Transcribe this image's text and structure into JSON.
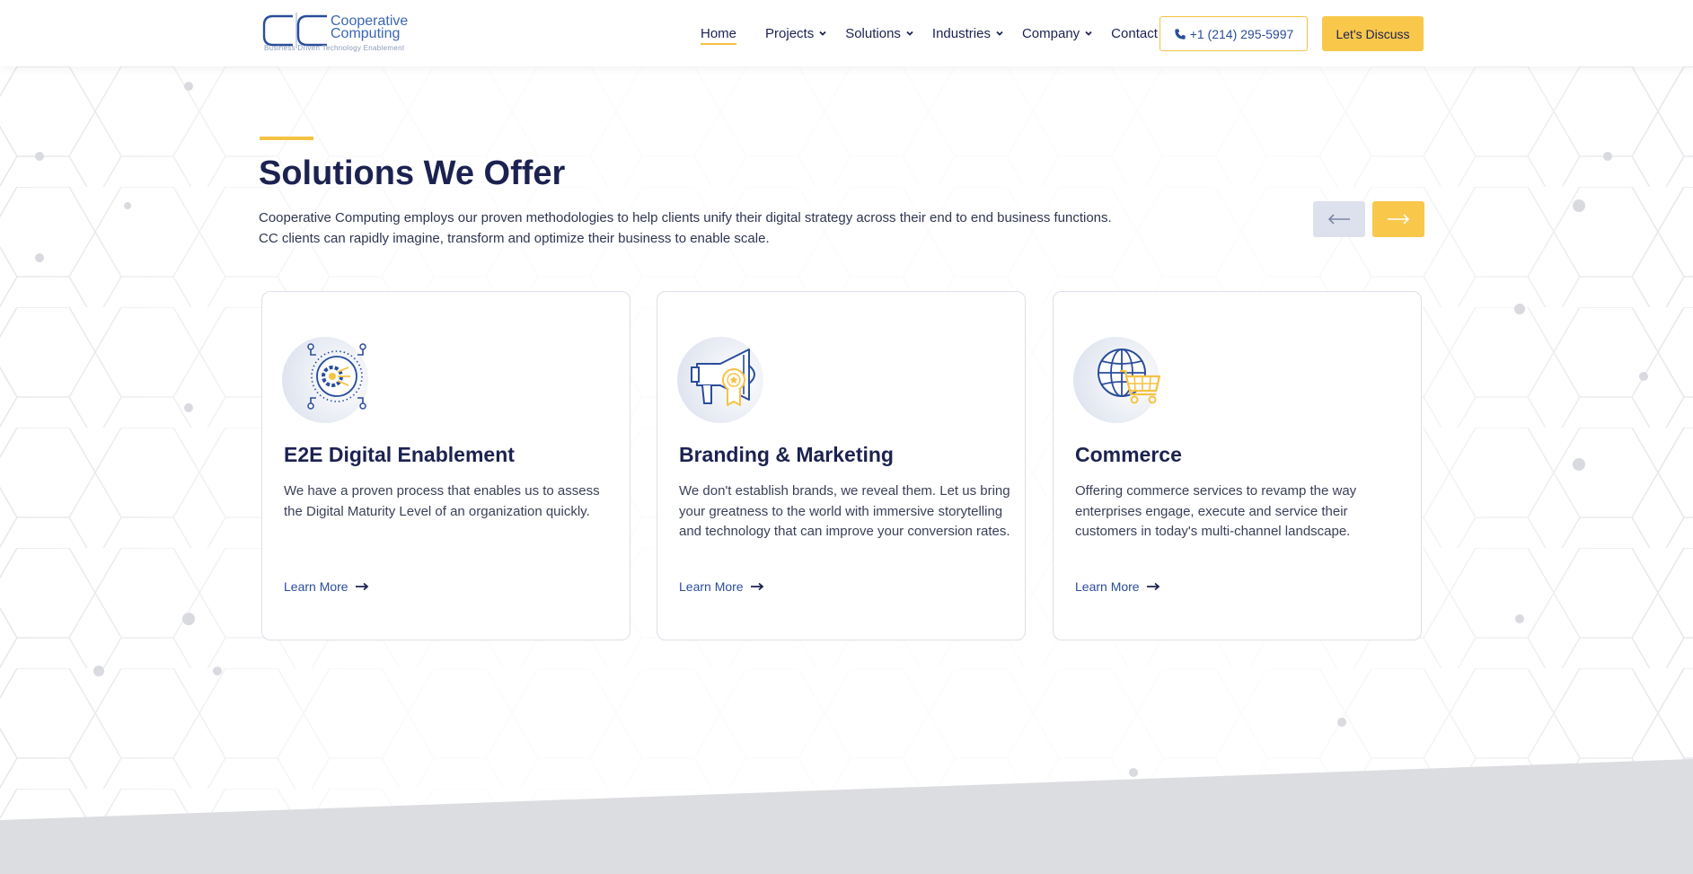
{
  "header": {
    "logo": {
      "letters": "CC",
      "name_line1": "Cooperative",
      "name_line2": "Computing",
      "tagline": "Business Driven Technology Enablement"
    },
    "nav": [
      {
        "label": "Home",
        "active": true,
        "dropdown": false
      },
      {
        "label": "Projects",
        "active": false,
        "dropdown": true
      },
      {
        "label": "Solutions",
        "active": false,
        "dropdown": true
      },
      {
        "label": "Industries",
        "active": false,
        "dropdown": true
      },
      {
        "label": "Company",
        "active": false,
        "dropdown": true
      },
      {
        "label": "Contact",
        "active": false,
        "dropdown": true
      }
    ],
    "phone": "+1 (214) 295-5997",
    "phone_icon": "phone-icon",
    "cta_label": "Let's Discuss"
  },
  "section": {
    "title": "Solutions We Offer",
    "desc_line1": "Cooperative Computing employs our proven methodologies to help clients unify their digital strategy across their end to end business functions.",
    "desc_line2": "CC clients can rapidly imagine, transform and optimize their business to enable scale.",
    "prev_icon": "arrow-left-icon",
    "next_icon": "arrow-right-icon"
  },
  "cards": [
    {
      "icon": "digital-gear-icon",
      "title": "E2E Digital Enablement",
      "text": "We have a proven process that enables us to assess the Digital Maturity Level of an organization quickly.",
      "link": "Learn More"
    },
    {
      "icon": "megaphone-award-icon",
      "title": "Branding & Marketing",
      "text": "We don't establish brands, we reveal them. Let us bring your greatness to the world with immersive storytelling and technology that can improve your conversion rates.",
      "link": "Learn More"
    },
    {
      "icon": "globe-cart-icon",
      "title": "Commerce",
      "text": "Offering commerce services to revamp the way enterprises engage, execute and service their customers in today's multi-channel landscape.",
      "link": "Learn More"
    }
  ],
  "colors": {
    "navy": "#1c2250",
    "blue": "#2a4d9b",
    "accent": "#f6c244",
    "band": "#dcdde0"
  }
}
